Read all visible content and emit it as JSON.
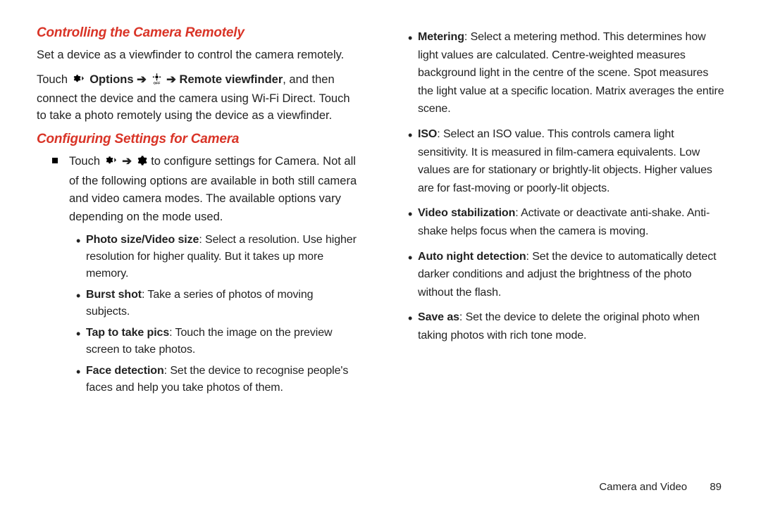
{
  "left": {
    "h_remote": "Controlling the Camera Remotely",
    "p_remote": "Set a device as a viewfinder to control the camera remotely.",
    "p_touch_pre": "Touch ",
    "p_touch_options": " Options",
    "arrow": " ➔ ",
    "p_touch_remote": " Remote viewfinder",
    "p_touch_post": ", and then connect the device and the camera using Wi-Fi Direct. Touch to take a photo remotely using the device as a viewfinder.",
    "h_config": "Configuring Settings for Camera",
    "config_intro_pre": "Touch ",
    "config_intro_post": " to configure settings for Camera. Not all of the following options are available in both still camera and video camera modes. The available options vary depending on the mode used.",
    "bullets": [
      {
        "t": "Photo size/Video size",
        "d": ": Select a resolution. Use higher resolution for higher quality. But it takes up more memory."
      },
      {
        "t": "Burst shot",
        "d": ": Take a series of photos of moving subjects."
      },
      {
        "t": "Tap to take pics",
        "d": ": Touch the image on the preview screen to take photos."
      },
      {
        "t": "Face detection",
        "d": ": Set the device to recognise people's faces and help you take photos of them."
      }
    ]
  },
  "right": {
    "bullets": [
      {
        "t": "Metering",
        "d": ": Select a metering method. This determines how light values are calculated. Centre-weighted measures background light in the centre of the scene. Spot measures the light value at a specific location. Matrix averages the entire scene."
      },
      {
        "t": "ISO",
        "d": ": Select an ISO value. This controls camera light sensitivity. It is measured in film-camera equivalents. Low values are for stationary or brightly-lit objects. Higher values are for fast-moving or poorly-lit objects."
      },
      {
        "t": "Video stabilization",
        "d": ": Activate or deactivate anti-shake. Anti-shake helps focus when the camera is moving."
      },
      {
        "t": "Auto night detection",
        "d": ": Set the device to automatically detect darker conditions and adjust the brightness of the photo without the flash."
      },
      {
        "t": "Save as",
        "d": ": Set the device to delete the original photo when taking photos with rich tone mode."
      }
    ]
  },
  "footer": {
    "section": "Camera and Video",
    "page": "89"
  }
}
